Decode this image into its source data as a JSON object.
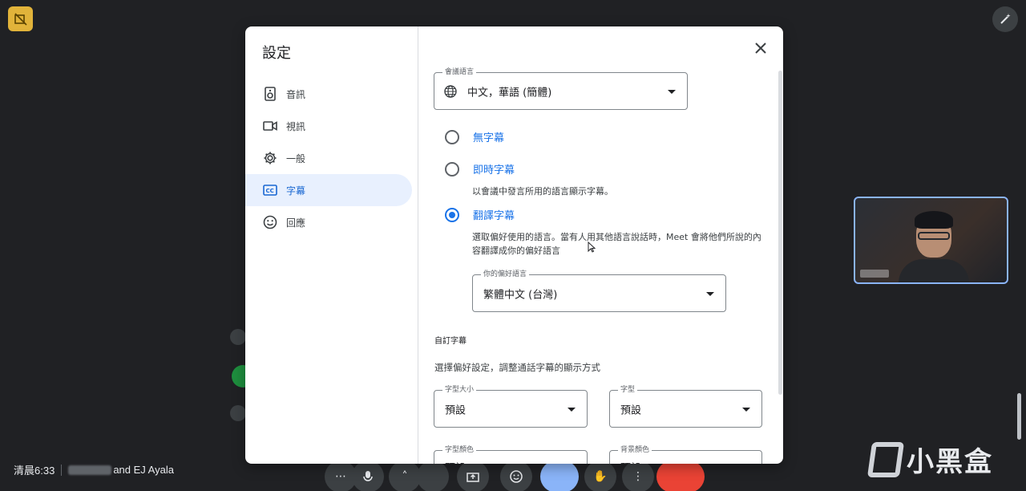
{
  "background": {
    "time_label": "清晨6:33",
    "participants_label": "and EJ Ayala",
    "watermark_text": "小黑盒"
  },
  "dialog": {
    "title": "設定",
    "nav": [
      {
        "label": "音訊",
        "icon": "speaker-icon",
        "active": false
      },
      {
        "label": "視訊",
        "icon": "video-camera-icon",
        "active": false
      },
      {
        "label": "一般",
        "icon": "gear-icon",
        "active": false
      },
      {
        "label": "字幕",
        "icon": "closed-captions-icon",
        "active": true
      },
      {
        "label": "回應",
        "icon": "smiley-icon",
        "active": false
      }
    ],
    "meeting_language": {
      "legend": "會議語言",
      "value": "中文，華語 (簡體)"
    },
    "options": [
      {
        "label": "無字幕",
        "checked": false
      },
      {
        "label": "即時字幕",
        "checked": false,
        "description": "以會議中發言所用的語言顯示字幕。"
      },
      {
        "label": "翻譯字幕",
        "checked": true,
        "description": "選取偏好使用的語言。當有人用其他語言說話時，Meet 會將他們所說的內容翻譯成你的偏好語言"
      }
    ],
    "preferred_language": {
      "legend": "你的偏好語言",
      "value": "繁體中文 (台灣)"
    },
    "custom_section": {
      "title": "自訂字幕",
      "subtitle": "選擇偏好設定，調整通話字幕的顯示方式"
    },
    "font_size": {
      "legend": "字型大小",
      "value": "預設"
    },
    "font": {
      "legend": "字型",
      "value": "預設"
    },
    "font_color": {
      "legend": "字型顏色",
      "value": "預設"
    },
    "bg_color": {
      "legend": "背景顏色",
      "value": "預設"
    }
  },
  "colors": {
    "accent": "#1a73e8",
    "active_nav_bg": "#e8f0fe",
    "end_call": "#ea4335",
    "meeting_bg": "#202124"
  }
}
